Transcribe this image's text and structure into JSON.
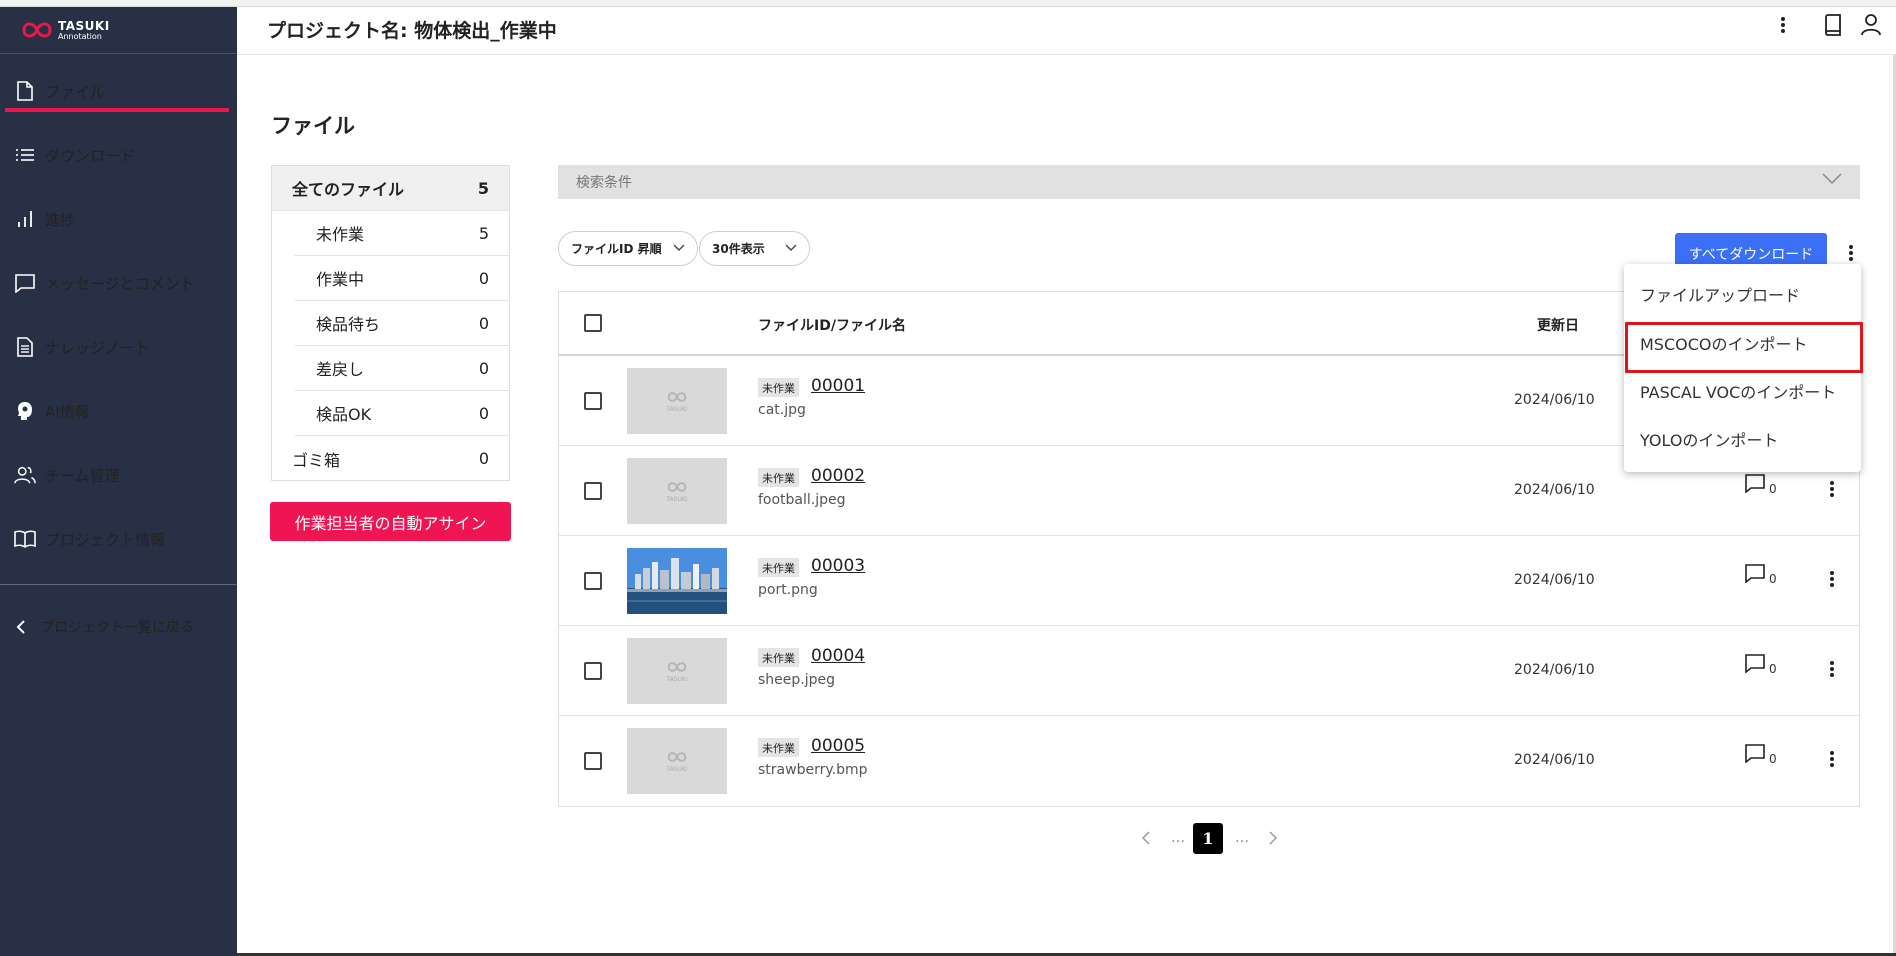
{
  "app": {
    "logo_main": "TASUKI",
    "logo_sub": "Annotation",
    "brand_color": "#e8174c"
  },
  "sidebar": {
    "items": [
      {
        "label": "ファイル",
        "icon": "file-icon",
        "active": true
      },
      {
        "label": "ダウンロード",
        "icon": "list-icon"
      },
      {
        "label": "進捗",
        "icon": "bar-chart-icon"
      },
      {
        "label": "メッセージとコメント",
        "icon": "message-icon"
      },
      {
        "label": "ナレッジノート",
        "icon": "document-icon"
      },
      {
        "label": "AI情報",
        "icon": "ai-head-icon"
      },
      {
        "label": "チーム管理",
        "icon": "team-icon"
      },
      {
        "label": "プロジェクト情報",
        "icon": "book-icon"
      }
    ],
    "back_label": "プロジェクト一覧に戻る"
  },
  "header": {
    "project_title": "プロジェクト名: 物体検出_作業中"
  },
  "page": {
    "section_title": "ファイル"
  },
  "filters": {
    "all": {
      "label": "全てのファイル",
      "count": "5"
    },
    "statuses": [
      {
        "label": "未作業",
        "count": "5"
      },
      {
        "label": "作業中",
        "count": "0"
      },
      {
        "label": "検品待ち",
        "count": "0"
      },
      {
        "label": "差戻し",
        "count": "0"
      },
      {
        "label": "検品OK",
        "count": "0"
      }
    ],
    "trash": {
      "label": "ゴミ箱",
      "count": "0"
    },
    "auto_assign_label": "作業担当者の自動アサイン"
  },
  "search": {
    "label": "検索条件"
  },
  "controls": {
    "sort_label": "ファイルID 昇順",
    "per_page_label": "30件表示",
    "download_all_label": "すべてダウンロード"
  },
  "table": {
    "col_file": "ファイルID/ファイル名",
    "col_date": "更新日",
    "rows": [
      {
        "status": "未作業",
        "id": "00001",
        "name": "cat.jpg",
        "date": "2024/06/10",
        "comments": "0",
        "thumb": "placeholder"
      },
      {
        "status": "未作業",
        "id": "00002",
        "name": "football.jpeg",
        "date": "2024/06/10",
        "comments": "0",
        "thumb": "placeholder"
      },
      {
        "status": "未作業",
        "id": "00003",
        "name": "port.png",
        "date": "2024/06/10",
        "comments": "0",
        "thumb": "photo"
      },
      {
        "status": "未作業",
        "id": "00004",
        "name": "sheep.jpeg",
        "date": "2024/06/10",
        "comments": "0",
        "thumb": "placeholder"
      },
      {
        "status": "未作業",
        "id": "00005",
        "name": "strawberry.bmp",
        "date": "2024/06/10",
        "comments": "0",
        "thumb": "placeholder"
      }
    ],
    "thumb_placeholder_text": "TASUKI"
  },
  "pagination": {
    "ellipsis": "…",
    "current": "1"
  },
  "dropdown": {
    "items": [
      {
        "label": "ファイルアップロード"
      },
      {
        "label": "MSCOCOのインポート",
        "highlighted": true
      },
      {
        "label": "PASCAL VOCのインポート"
      },
      {
        "label": "YOLOのインポート"
      }
    ],
    "highlight_color": "#e0151a"
  }
}
